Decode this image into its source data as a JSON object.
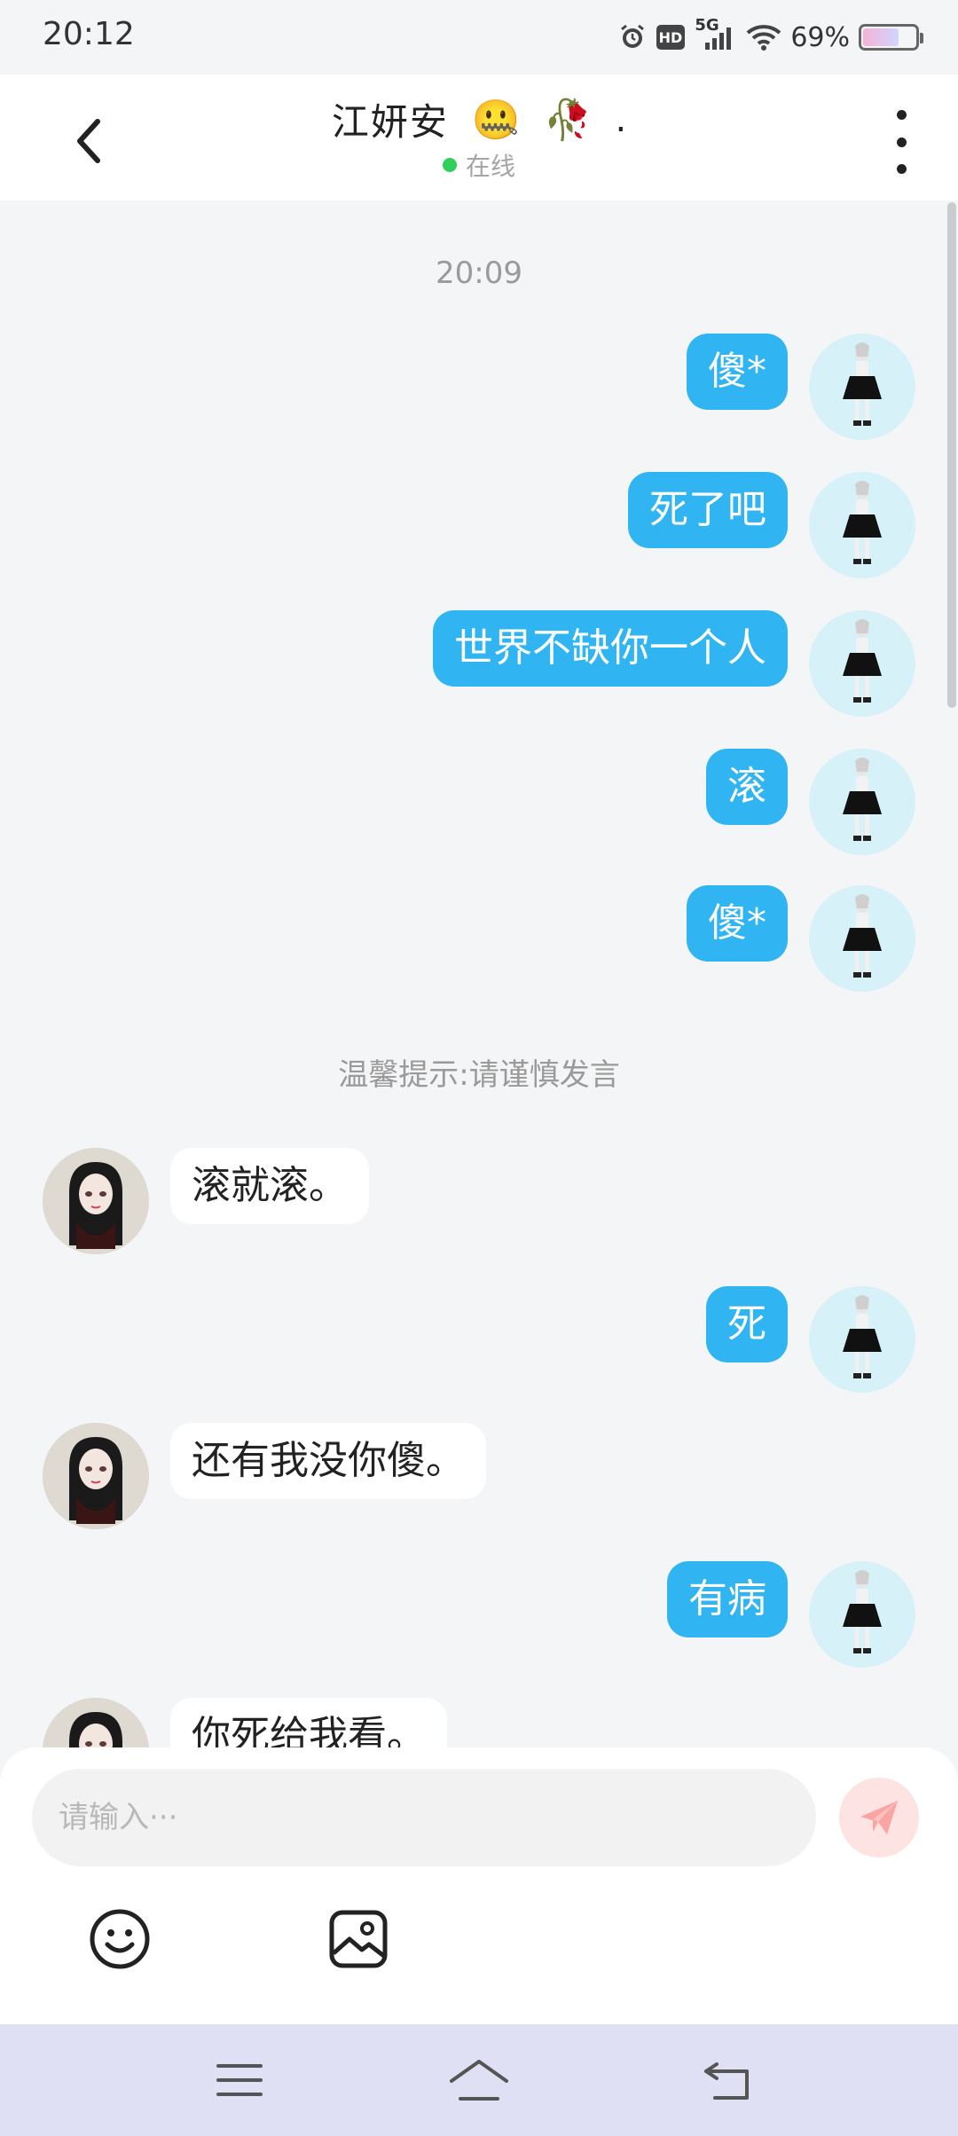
{
  "status_bar": {
    "time": "20:12",
    "network": "5G",
    "hd": "HD",
    "battery": "69%",
    "battery_level": 0.69
  },
  "header": {
    "contact_name": "江妍安",
    "emoji1": "🤐",
    "emoji2": "🥀",
    "trailing": ".",
    "status": "在线",
    "icons": {
      "back": "chevron-left-icon",
      "more": "more-vertical-icon"
    }
  },
  "chat": {
    "timestamp": "20:09",
    "notice": "温馨提示:请谨慎发言",
    "messages": [
      {
        "side": "me",
        "text": "傻*"
      },
      {
        "side": "me",
        "text": "死了吧"
      },
      {
        "side": "me",
        "text": "世界不缺你一个人"
      },
      {
        "side": "me",
        "text": "滚"
      },
      {
        "side": "me",
        "text": "傻*"
      },
      {
        "side": "them",
        "text": "滚就滚。"
      },
      {
        "side": "me",
        "text": "死"
      },
      {
        "side": "them",
        "text": "还有我没你傻。"
      },
      {
        "side": "me",
        "text": "有病"
      },
      {
        "side": "them",
        "text": "你死给我看。"
      }
    ]
  },
  "composer": {
    "placeholder": "请输入···",
    "icons": {
      "send": "send-icon",
      "emoji": "emoji-icon",
      "image": "image-icon"
    }
  },
  "navbar": {
    "icons": [
      "menu-icon",
      "home-icon",
      "back-icon"
    ]
  },
  "colors": {
    "accent": "#31b5f2",
    "online": "#2fcf5a",
    "send_bg": "#fde3e2",
    "send_icon": "#f9a5a4",
    "background": "#f4f5f7",
    "navbar": "#dfe0f3"
  }
}
